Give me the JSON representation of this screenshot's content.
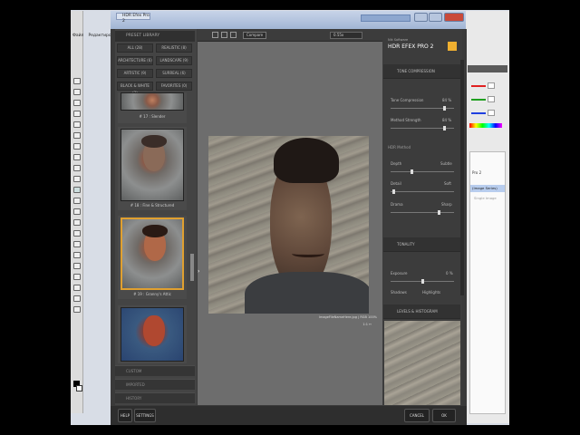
{
  "window": {
    "title": "HDR Efex Pro 2"
  },
  "photoshop": {
    "menu": [
      "Файл",
      "Редактирование"
    ]
  },
  "library": {
    "header": "PRESET LIBRARY",
    "filters": [
      {
        "label": "ALL (28)",
        "id": "all"
      },
      {
        "label": "REALISTIC (8)",
        "id": "realistic"
      },
      {
        "label": "ARCHITECTURE (6)",
        "id": "architecture"
      },
      {
        "label": "LANDSCAPE (9)",
        "id": "landscape"
      },
      {
        "label": "ARTISTIC (9)",
        "id": "artistic"
      },
      {
        "label": "SURREAL (6)",
        "id": "surreal"
      },
      {
        "label": "BLACK & WHITE (3)",
        "id": "bw"
      },
      {
        "label": "FAVORITES (0)",
        "id": "favorites"
      }
    ],
    "presets": [
      {
        "caption": "# 17 : Slender"
      },
      {
        "caption": "# 18 : Fine & Structured"
      },
      {
        "caption": "# 19 : Granny's Attic"
      },
      {
        "caption": ""
      }
    ],
    "sections": [
      "CUSTOM",
      "IMPORTED",
      "HISTORY"
    ]
  },
  "toolbar": {
    "compare": "Compare",
    "zoom": "0.55x"
  },
  "canvas": {
    "filename": "ImageFileNameHere.jpg  |  RGB  100%",
    "zoom_label": "1:1 ↔"
  },
  "right": {
    "brand_small": "Nik Software",
    "brand_big": "HDR EFEX PRO 2",
    "sections": {
      "tone": "TONE COMPRESSION",
      "hdr": "HDR Method",
      "tonality": "TONALITY",
      "levels": "LEVELS & HISTOGRAM"
    },
    "sliders": {
      "tone_compression": {
        "label": "Tone Compression",
        "value": "84 %"
      },
      "method_strength": {
        "label": "Method Strength",
        "value": "84 %"
      },
      "depth": {
        "label": "Depth",
        "value": "Subtle"
      },
      "detail": {
        "label": "Detail",
        "value": "Soft"
      },
      "drama": {
        "label": "Drama",
        "value": "Sharp"
      },
      "exposure": {
        "label": "Exposure",
        "value": "0 %"
      },
      "shadows": {
        "label": "Shadows"
      },
      "highlights": {
        "label": "Highlights"
      }
    }
  },
  "bottom": {
    "help": "HELP",
    "settings": "SETTINGS",
    "cancel": "CANCEL",
    "ok": "OK"
  },
  "ps_right": {
    "layer_label": "Pro 2",
    "smart": "(Image Series)",
    "item2": "Single Image"
  }
}
